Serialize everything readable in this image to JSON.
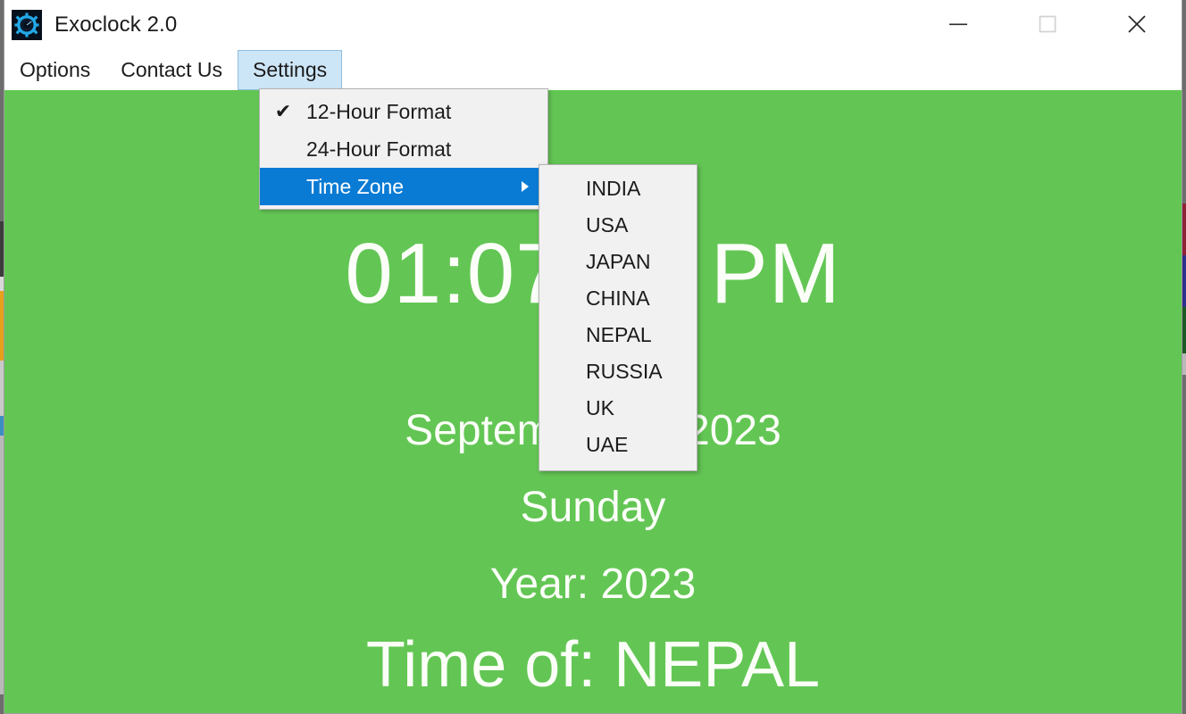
{
  "window": {
    "title": "Exoclock 2.0",
    "icon": "gear-icon",
    "controls": {
      "minimize": "minimize-icon",
      "maximize": "maximize-icon",
      "close": "close-icon"
    }
  },
  "menubar": {
    "items": [
      {
        "label": "Options",
        "active": false
      },
      {
        "label": "Contact Us",
        "active": false
      },
      {
        "label": "Settings",
        "active": true
      }
    ]
  },
  "settings_menu": {
    "items": [
      {
        "label": "12-Hour Format",
        "checked": true,
        "checkmark": "✔",
        "highlighted": false,
        "submenu": false
      },
      {
        "label": "24-Hour Format",
        "checked": false,
        "checkmark": "",
        "highlighted": false,
        "submenu": false
      },
      {
        "label": "Time Zone",
        "checked": false,
        "checkmark": "",
        "highlighted": true,
        "submenu": true
      }
    ]
  },
  "timezone_submenu": {
    "items": [
      "INDIA",
      "USA",
      "JAPAN",
      "CHINA",
      "NEPAL",
      "RUSSIA",
      "UK",
      "UAE"
    ]
  },
  "clock": {
    "time": "01:07:12 PM",
    "date": "September 17 2023",
    "day": "Sunday",
    "year_label": "Year: 2023",
    "zone_label": "Time of: NEPAL"
  },
  "colors": {
    "client_background": "#63c654",
    "clock_text": "#fbfff8",
    "menu_highlight": "#0a7bd4",
    "menubar_active": "#cde6f7",
    "menu_background": "#f1f1f1"
  }
}
